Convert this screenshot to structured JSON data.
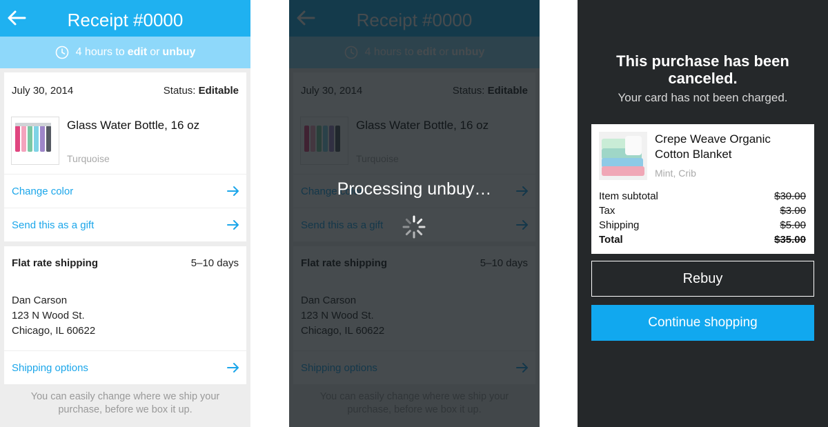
{
  "receipt": {
    "title": "Receipt #0000",
    "edit_window": {
      "prefix": "4 hours to",
      "edit": "edit",
      "or": "or",
      "unbuy": "unbuy"
    },
    "date": "July 30, 2014",
    "status_label": "Status:",
    "status_value": "Editable",
    "product": {
      "name": "Glass Water Bottle, 16 oz",
      "variant": "Turquoise"
    },
    "actions": {
      "change_color": "Change color",
      "send_gift": "Send this as a gift"
    },
    "shipping": {
      "title": "Flat rate shipping",
      "days": "5–10 days",
      "address": [
        "Dan Carson",
        "123 N Wood St.",
        "Chicago, IL 60622"
      ],
      "options_link": "Shipping options"
    },
    "note": "You can easily change where we ship your purchase, before we box it up."
  },
  "processing": {
    "text": "Processing unbuy…"
  },
  "canceled": {
    "title": "This purchase has been canceled.",
    "subtitle": "Your card has not been charged.",
    "product": {
      "name": "Crepe Weave Organic Cotton Blanket",
      "variant": "Mint, Crib"
    },
    "lines": [
      {
        "label": "Item subtotal",
        "amount": "$30.00"
      },
      {
        "label": "Tax",
        "amount": "$3.00"
      },
      {
        "label": "Shipping",
        "amount": "$5.00"
      },
      {
        "label": "Total",
        "amount": "$35.00"
      }
    ],
    "rebuy_label": "Rebuy",
    "continue_label": "Continue shopping"
  },
  "colors": {
    "accent": "#1fb1f0",
    "banner": "#8ed8fa",
    "link": "#1ba6ea",
    "dark_bg": "#25282a",
    "button_blue": "#11a8ef"
  },
  "icons": [
    "back-arrow-icon",
    "clock-icon",
    "arrow-right-icon",
    "spinner-icon"
  ]
}
